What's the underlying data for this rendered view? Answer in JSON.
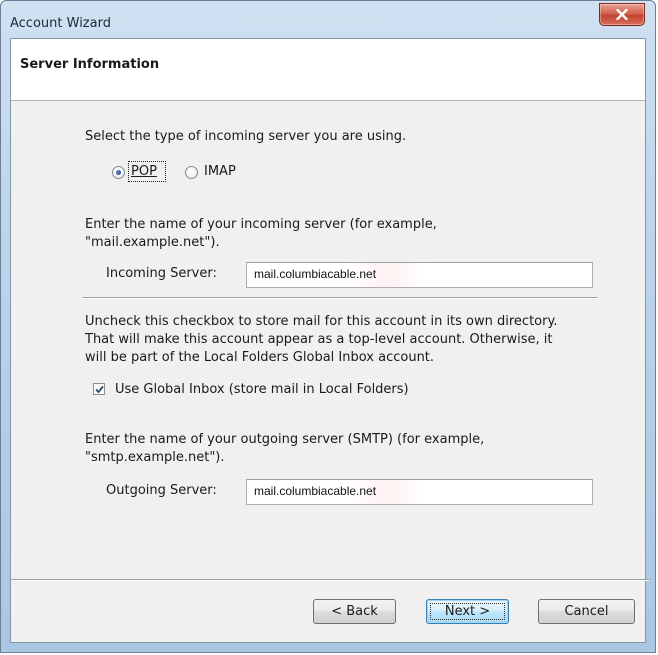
{
  "window": {
    "title": "Account Wizard"
  },
  "header": {
    "title": "Server Information"
  },
  "server_type": {
    "prompt": "Select the type of incoming server you are using.",
    "options": [
      {
        "label": "POP",
        "selected": true
      },
      {
        "label": "IMAP",
        "selected": false
      }
    ]
  },
  "incoming": {
    "instructions_line1": "Enter the name of your incoming server (for example,",
    "instructions_line2": "\"mail.example.net\").",
    "label": "Incoming Server:",
    "value": "mail.columbiacable.net"
  },
  "global_inbox": {
    "description_line1": "Uncheck this checkbox to store mail for this account in its own directory.",
    "description_line2": "That will make this account appear as a top-level account. Otherwise, it",
    "description_line3": "will be part of the Local Folders Global Inbox account.",
    "checkbox_label": "Use Global Inbox (store mail in Local Folders)",
    "checked": true
  },
  "outgoing": {
    "instructions_line1": "Enter the name of your outgoing server (SMTP) (for example,",
    "instructions_line2": "\"smtp.example.net\").",
    "label": "Outgoing Server:",
    "value": "mail.columbiacable.net"
  },
  "buttons": {
    "back": "< Back",
    "next": "Next >",
    "cancel": "Cancel"
  },
  "icons": {
    "close": "close-icon",
    "check": "checkmark-icon"
  },
  "colors": {
    "close_button": "#c9503d",
    "default_button_border": "#3c7fb1",
    "dialog_background": "#f0f0f0"
  }
}
